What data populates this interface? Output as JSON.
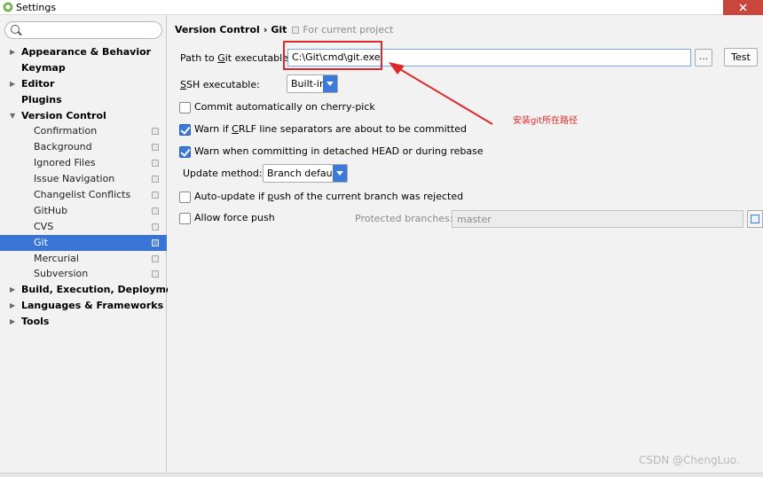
{
  "window": {
    "title": "Settings"
  },
  "search": {
    "placeholder": ""
  },
  "sidebar": {
    "items": [
      {
        "label": "Appearance & Behavior",
        "bold": true,
        "arrow": "right",
        "child": false
      },
      {
        "label": "Keymap",
        "bold": true,
        "arrow": "",
        "child": false
      },
      {
        "label": "Editor",
        "bold": true,
        "arrow": "right",
        "child": false
      },
      {
        "label": "Plugins",
        "bold": true,
        "arrow": "",
        "child": false
      },
      {
        "label": "Version Control",
        "bold": true,
        "arrow": "down",
        "child": false
      },
      {
        "label": "Confirmation",
        "bold": false,
        "arrow": "",
        "child": true,
        "project_icon": true
      },
      {
        "label": "Background",
        "bold": false,
        "arrow": "",
        "child": true,
        "project_icon": true
      },
      {
        "label": "Ignored Files",
        "bold": false,
        "arrow": "",
        "child": true,
        "project_icon": true
      },
      {
        "label": "Issue Navigation",
        "bold": false,
        "arrow": "",
        "child": true,
        "project_icon": true
      },
      {
        "label": "Changelist Conflicts",
        "bold": false,
        "arrow": "",
        "child": true,
        "project_icon": true
      },
      {
        "label": "GitHub",
        "bold": false,
        "arrow": "",
        "child": true,
        "project_icon": true
      },
      {
        "label": "CVS",
        "bold": false,
        "arrow": "",
        "child": true,
        "project_icon": true
      },
      {
        "label": "Git",
        "bold": false,
        "arrow": "",
        "child": true,
        "project_icon": true,
        "selected": true
      },
      {
        "label": "Mercurial",
        "bold": false,
        "arrow": "",
        "child": true,
        "project_icon": true
      },
      {
        "label": "Subversion",
        "bold": false,
        "arrow": "",
        "child": true,
        "project_icon": true
      },
      {
        "label": "Build, Execution, Deployment",
        "bold": true,
        "arrow": "right",
        "child": false
      },
      {
        "label": "Languages & Frameworks",
        "bold": true,
        "arrow": "right",
        "child": false
      },
      {
        "label": "Tools",
        "bold": true,
        "arrow": "right",
        "child": false
      }
    ]
  },
  "breadcrumb": {
    "parent": "Version Control",
    "separator": "›",
    "current": "Git",
    "scope": "For current project"
  },
  "git": {
    "path_label_pre": "Path to ",
    "path_label_u": "G",
    "path_label_post": "it executable:",
    "path_value": "C:\\Git\\cmd\\git.exe",
    "browse_label": "...",
    "test_label": "Test",
    "ssh_label_u": "S",
    "ssh_label_post": "SH executable:",
    "ssh_value": "Built-in",
    "cherry_pick": {
      "label": "Commit automatically on cherry-pick",
      "checked": false
    },
    "crlf": {
      "label_pre": "Warn if ",
      "label_u": "C",
      "label_post": "RLF line separators are about to be committed",
      "checked": true
    },
    "detached": {
      "label": "Warn when committing in detached HEAD or during rebase",
      "checked": true
    },
    "update_label": "Update method:",
    "update_value": "Branch default",
    "auto_update": {
      "label_pre": "Auto-update if ",
      "label_u": "p",
      "label_post": "ush of the current branch was rejected",
      "checked": false
    },
    "force_push": {
      "label": "Allow force push",
      "checked": false
    },
    "protected_label": "Protected branches:",
    "protected_value": "master"
  },
  "annotation": {
    "text": "安装git所在路径",
    "color": "#e0282a"
  },
  "watermark": "CSDN @ChengLuo.",
  "colors": {
    "selection": "#3875d7",
    "accent": "#3b7ad9",
    "annotation": "#e0282a"
  }
}
